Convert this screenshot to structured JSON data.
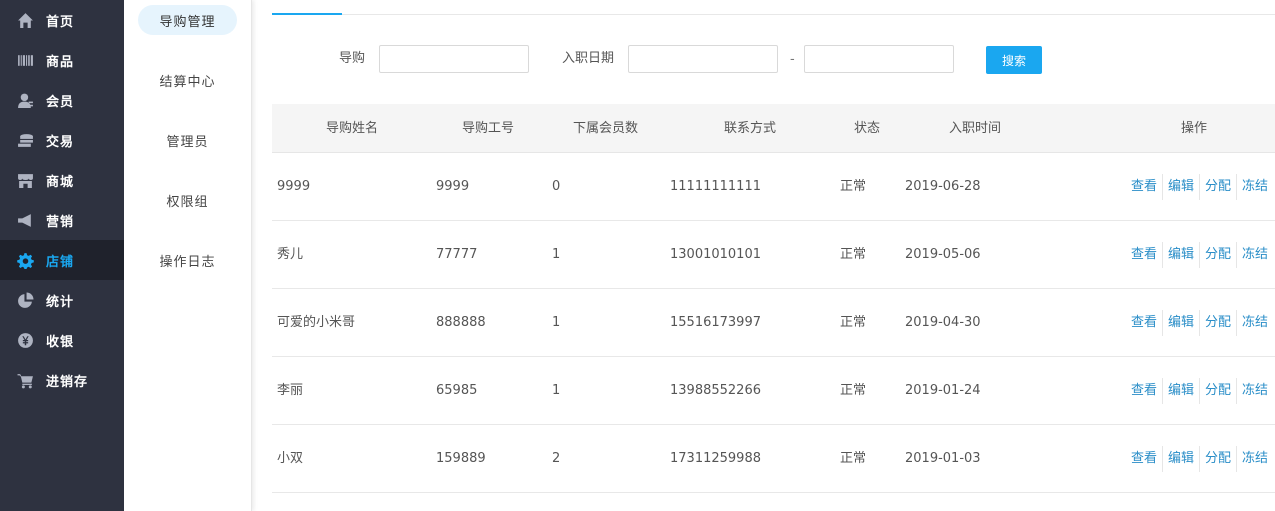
{
  "nav_primary": [
    {
      "label": "首页",
      "icon": "home-icon"
    },
    {
      "label": "商品",
      "icon": "barcode-icon"
    },
    {
      "label": "会员",
      "icon": "member-icon"
    },
    {
      "label": "交易",
      "icon": "coins-icon"
    },
    {
      "label": "商城",
      "icon": "store-icon"
    },
    {
      "label": "营销",
      "icon": "megaphone-icon"
    },
    {
      "label": "店铺",
      "icon": "gear-icon",
      "active": true
    },
    {
      "label": "统计",
      "icon": "pie-chart-icon"
    },
    {
      "label": "收银",
      "icon": "yuan-icon"
    },
    {
      "label": "进销存",
      "icon": "cart-icon"
    }
  ],
  "nav_secondary": [
    {
      "label": "导购管理",
      "active": true
    },
    {
      "label": "结算中心"
    },
    {
      "label": "管理员"
    },
    {
      "label": "权限组"
    },
    {
      "label": "操作日志"
    }
  ],
  "search": {
    "guide_label": "导购",
    "guide_value": "",
    "date_label": "入职日期",
    "date_start": "",
    "date_sep": "-",
    "date_end": "",
    "button": "搜索"
  },
  "table": {
    "columns": [
      "导购姓名",
      "导购工号",
      "下属会员数",
      "联系方式",
      "状态",
      "入职时间",
      "操作"
    ],
    "actions": [
      "查看",
      "编辑",
      "分配",
      "冻结"
    ],
    "rows": [
      {
        "name": "9999",
        "id": "9999",
        "members": "0",
        "phone": "11111111111",
        "status": "正常",
        "date": "2019-06-28"
      },
      {
        "name": "秀儿",
        "id": "77777",
        "members": "1",
        "phone": "13001010101",
        "status": "正常",
        "date": "2019-05-06"
      },
      {
        "name": "可爱的小米哥",
        "id": "888888",
        "members": "1",
        "phone": "15516173997",
        "status": "正常",
        "date": "2019-04-30"
      },
      {
        "name": "李丽",
        "id": "65985",
        "members": "1",
        "phone": "13988552266",
        "status": "正常",
        "date": "2019-01-24"
      },
      {
        "name": "小双",
        "id": "159889",
        "members": "2",
        "phone": "17311259988",
        "status": "正常",
        "date": "2019-01-03"
      }
    ]
  },
  "colors": {
    "sidebar_bg": "#2e3240",
    "sidebar_active_bg": "#1f222c",
    "accent": "#1aa7f0",
    "link": "#2a8ec8"
  }
}
